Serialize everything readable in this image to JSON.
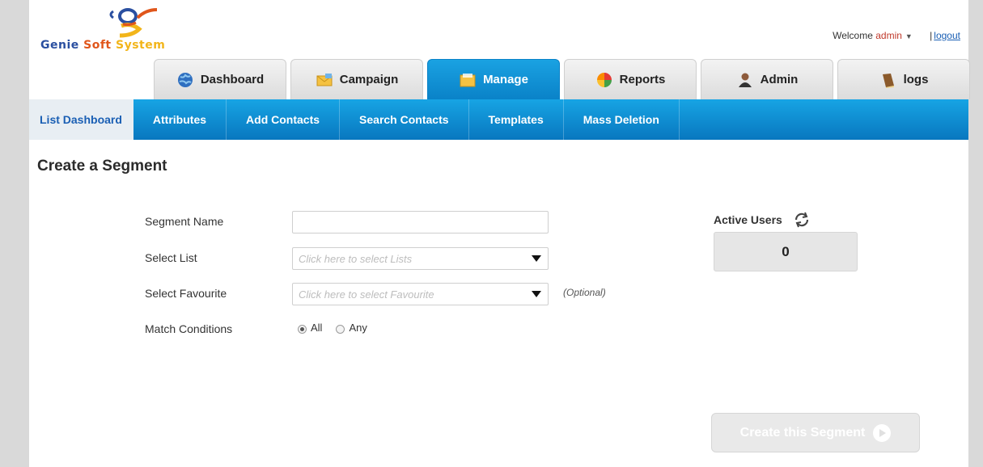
{
  "brand": {
    "part1": "Genie ",
    "part2": "Soft ",
    "part3": "System"
  },
  "header": {
    "welcome_prefix": "Welcome ",
    "user": "admin",
    "separator": "|",
    "logout": "logout"
  },
  "tabs": [
    {
      "label": "Dashboard",
      "icon": "globe-icon"
    },
    {
      "label": "Campaign",
      "icon": "envelope-icon"
    },
    {
      "label": "Manage",
      "icon": "folder-icon",
      "active": true
    },
    {
      "label": "Reports",
      "icon": "pie-chart-icon"
    },
    {
      "label": "Admin",
      "icon": "user-icon"
    },
    {
      "label": "logs",
      "icon": "book-icon"
    }
  ],
  "subnav": [
    {
      "label": "List Dashboard",
      "active": true
    },
    {
      "label": "Attributes"
    },
    {
      "label": "Add Contacts"
    },
    {
      "label": "Search Contacts"
    },
    {
      "label": "Templates"
    },
    {
      "label": "Mass Deletion"
    }
  ],
  "page_title": "Create a Segment",
  "form": {
    "segment_name_label": "Segment Name",
    "segment_name_value": "",
    "select_list_label": "Select List",
    "select_list_placeholder": "Click here to select Lists",
    "select_favourite_label": "Select Favourite",
    "select_favourite_placeholder": "Click here to select Favourite",
    "optional": "(Optional)",
    "match_conditions_label": "Match Conditions",
    "match_all": "All",
    "match_any": "Any",
    "match_selected": "All"
  },
  "active_users": {
    "label": "Active Users",
    "count": "0"
  },
  "create_button": "Create this Segment",
  "colors": {
    "accent": "#0a82c8",
    "nav_gradient_top": "#17a4e4",
    "user_name": "#c0392b",
    "link": "#1a5fb4"
  }
}
